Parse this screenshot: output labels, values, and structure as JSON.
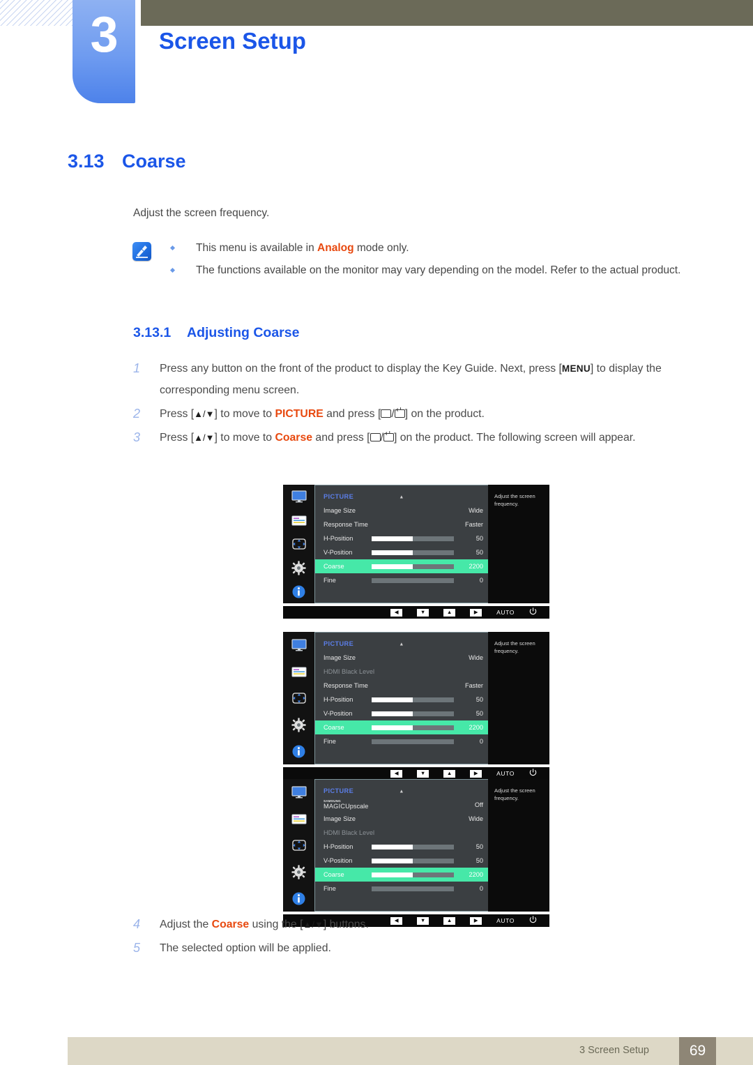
{
  "header": {
    "chapter_number": "3",
    "chapter_title": "Screen Setup"
  },
  "section": {
    "number": "3.13",
    "title": "Coarse",
    "intro": "Adjust the screen frequency."
  },
  "note": {
    "icon": "note-pen-icon",
    "items": [
      {
        "pre": "This menu is available in ",
        "highlight": "Analog",
        "post": " mode only."
      },
      {
        "pre": "The functions available on the monitor may vary depending on the model. Refer to the actual product.",
        "highlight": "",
        "post": ""
      }
    ]
  },
  "subsection": {
    "number": "3.13.1",
    "title": "Adjusting Coarse"
  },
  "steps": [
    {
      "index": "1",
      "segments": [
        {
          "type": "text",
          "value": "Press any button on the front of the product to display the Key Guide. Next, press ["
        },
        {
          "type": "kbd",
          "value": "MENU"
        },
        {
          "type": "text",
          "value": "] to display the corresponding menu screen."
        }
      ]
    },
    {
      "index": "2",
      "segments": [
        {
          "type": "text",
          "value": "Press ["
        },
        {
          "type": "glyph",
          "value": "▲/▼"
        },
        {
          "type": "text",
          "value": "] to move to "
        },
        {
          "type": "hl",
          "value": "PICTURE"
        },
        {
          "type": "text",
          "value": " and press ["
        },
        {
          "type": "btns",
          "value": ""
        },
        {
          "type": "text",
          "value": "] on the product."
        }
      ]
    },
    {
      "index": "3",
      "segments": [
        {
          "type": "text",
          "value": "Press ["
        },
        {
          "type": "glyph",
          "value": "▲/▼"
        },
        {
          "type": "text",
          "value": "] to move to "
        },
        {
          "type": "hl",
          "value": "Coarse"
        },
        {
          "type": "text",
          "value": " and press ["
        },
        {
          "type": "btns",
          "value": ""
        },
        {
          "type": "text",
          "value": "] on the product. The following screen will appear."
        }
      ]
    }
  ],
  "steps_tail": [
    {
      "index": "4",
      "segments": [
        {
          "type": "text",
          "value": "Adjust the "
        },
        {
          "type": "hl",
          "value": "Coarse"
        },
        {
          "type": "text",
          "value": " using the ["
        },
        {
          "type": "glyph",
          "value": "▲/▼"
        },
        {
          "type": "text",
          "value": "] buttons."
        }
      ]
    },
    {
      "index": "5",
      "segments": [
        {
          "type": "text",
          "value": "The selected option will be applied."
        }
      ]
    }
  ],
  "osd_common": {
    "menu_title": "PICTURE",
    "help_text": "Adjust the screen frequency.",
    "sidebar_icons": [
      "monitor-icon",
      "list-icon",
      "dpad-icon",
      "gear-icon",
      "info-icon"
    ],
    "bottom_buttons": [
      {
        "name": "left-button",
        "glyph": "◀"
      },
      {
        "name": "down-button",
        "glyph": "▼"
      },
      {
        "name": "up-button",
        "glyph": "▲"
      },
      {
        "name": "right-button",
        "glyph": "▶"
      }
    ],
    "auto_label": "AUTO",
    "power_glyph": "⏻",
    "highlight_color": "#46e8a8",
    "title_color": "#5b7ee8"
  },
  "osd_screens": [
    {
      "id": "osd-1",
      "rows": [
        {
          "label": "Image Size",
          "value": "Wide",
          "type": "value",
          "dim": false,
          "selected": false
        },
        {
          "label": "Response Time",
          "value": "Faster",
          "type": "value",
          "dim": false,
          "selected": false
        },
        {
          "label": "H-Position",
          "value": "50",
          "type": "slider",
          "fill": 50,
          "dim": false,
          "selected": false
        },
        {
          "label": "V-Position",
          "value": "50",
          "type": "slider",
          "fill": 50,
          "dim": false,
          "selected": false
        },
        {
          "label": "Coarse",
          "value": "2200",
          "type": "slider",
          "fill": 50,
          "dim": false,
          "selected": true
        },
        {
          "label": "Fine",
          "value": "0",
          "type": "slider",
          "fill": 0,
          "dim": false,
          "selected": false
        }
      ]
    },
    {
      "id": "osd-2",
      "rows": [
        {
          "label": "Image Size",
          "value": "Wide",
          "type": "value",
          "dim": false,
          "selected": false
        },
        {
          "label": "HDMI Black Level",
          "value": "",
          "type": "value",
          "dim": true,
          "selected": false
        },
        {
          "label": "Response Time",
          "value": "Faster",
          "type": "value",
          "dim": false,
          "selected": false
        },
        {
          "label": "H-Position",
          "value": "50",
          "type": "slider",
          "fill": 50,
          "dim": false,
          "selected": false
        },
        {
          "label": "V-Position",
          "value": "50",
          "type": "slider",
          "fill": 50,
          "dim": false,
          "selected": false
        },
        {
          "label": "Coarse",
          "value": "2200",
          "type": "slider",
          "fill": 50,
          "dim": false,
          "selected": true
        },
        {
          "label": "Fine",
          "value": "0",
          "type": "slider",
          "fill": 0,
          "dim": false,
          "selected": false
        }
      ]
    },
    {
      "id": "osd-3",
      "rows": [
        {
          "label": "MAGIC Upscale",
          "value": "Off",
          "type": "magic",
          "magic_top": "SAMSUNG",
          "magic_main": "MAGIC",
          "magic_suffix": "Upscale",
          "dim": false,
          "selected": false
        },
        {
          "label": "Image Size",
          "value": "Wide",
          "type": "value",
          "dim": false,
          "selected": false
        },
        {
          "label": "HDMI Black Level",
          "value": "",
          "type": "value",
          "dim": true,
          "selected": false
        },
        {
          "label": "H-Position",
          "value": "50",
          "type": "slider",
          "fill": 50,
          "dim": false,
          "selected": false
        },
        {
          "label": "V-Position",
          "value": "50",
          "type": "slider",
          "fill": 50,
          "dim": false,
          "selected": false
        },
        {
          "label": "Coarse",
          "value": "2200",
          "type": "slider",
          "fill": 50,
          "dim": false,
          "selected": true
        },
        {
          "label": "Fine",
          "value": "0",
          "type": "slider",
          "fill": 0,
          "dim": false,
          "selected": false
        }
      ]
    }
  ],
  "footer": {
    "text": "3 Screen Setup",
    "page": "69"
  }
}
